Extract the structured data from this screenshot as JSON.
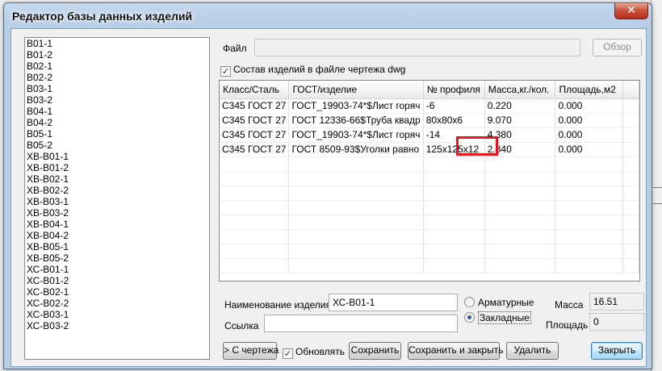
{
  "window": {
    "title": "Редактор базы данных изделий",
    "close_glyph": "✕"
  },
  "items_list": [
    "В01-1",
    "В01-2",
    "В02-1",
    "В02-2",
    "В03-1",
    "В03-2",
    "В04-1",
    "В04-2",
    "В05-1",
    "В05-2",
    "ХВ-В01-1",
    "ХВ-В01-2",
    "ХВ-В02-1",
    "ХВ-В02-2",
    "ХВ-В03-1",
    "ХВ-В03-2",
    "ХВ-В04-1",
    "ХВ-В04-2",
    "ХВ-В05-1",
    "ХВ-В05-2",
    "ХС-В01-1",
    "ХС-В01-2",
    "ХС-В02-1",
    "ХС-В02-2",
    "ХС-В03-1",
    "ХС-В03-2"
  ],
  "file": {
    "label": "Файл",
    "value": "",
    "browse_label": "Обзор"
  },
  "dwg_checkbox": {
    "checked": true,
    "label": "Состав изделий в файле чертежа dwg"
  },
  "table": {
    "columns": [
      "Класс/Сталь",
      "ГОСТ/изделие",
      "№ профиля",
      "Масса,кг./кол.",
      "Площадь,м2"
    ],
    "rows": [
      [
        "С345 ГОСТ 27",
        "ГОСТ_19903-74*$Лист горяч",
        "-6",
        "0.220",
        "0.000"
      ],
      [
        "С345 ГОСТ 27",
        "ГОСТ 12336-66$Труба квадр",
        "80х80х6",
        "9.070",
        "0.000"
      ],
      [
        "С345 ГОСТ 27",
        "ГОСТ_19903-74*$Лист горяч",
        "-14",
        "4.380",
        "0.000"
      ],
      [
        "С345 ГОСТ 27",
        "ГОСТ 8509-93$Уголки равно",
        "125х125х12",
        "2.840",
        "0.000"
      ]
    ],
    "highlight_color": "#e8141b"
  },
  "form": {
    "name_label": "Наименование изделия",
    "name_value": "ХС-В01-1",
    "link_label": "Ссылка",
    "link_value": "",
    "radio_rebar": "Арматурные",
    "radio_embedded": "Закладные",
    "selected_radio": "Закладные",
    "mass_label": "Масса",
    "mass_value": "16.51",
    "area_label": "Площадь",
    "area_value": "0"
  },
  "buttons": {
    "from_drawing": "> С чертежа",
    "update_label": "Обновлять",
    "update_checked": true,
    "save": "Сохранить",
    "save_close": "Сохранить и закрыть",
    "delete": "Удалить",
    "close": "Закрыть"
  }
}
